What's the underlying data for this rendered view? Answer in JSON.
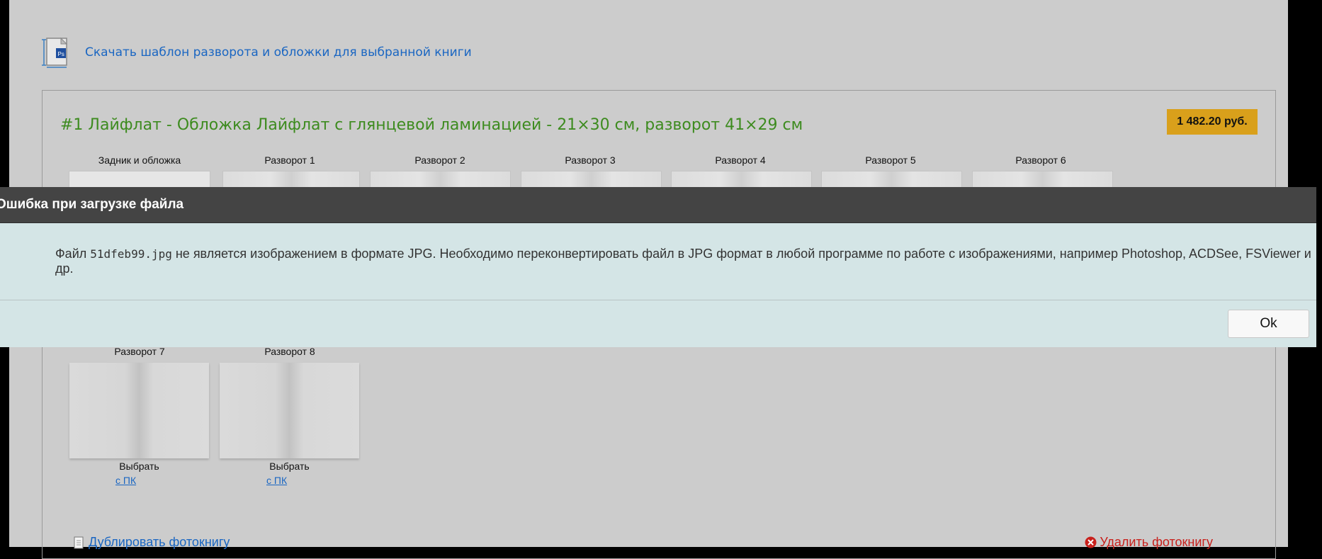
{
  "download": {
    "icon": "photoshop-template-icon",
    "link": "Скачать шаблон разворота и обложки для выбранной книги"
  },
  "order": {
    "title": "#1 Лайфлат - Обложка Лайфлат с глянцевой ламинацией - 21×30 см, разворот 41×29 см",
    "price": "1 482.20 руб.",
    "spreads_top": [
      "Задник и обложка",
      "Разворот 1",
      "Разворот 2",
      "Разворот 3",
      "Разворот 4",
      "Разворот 5",
      "Разворот 6"
    ],
    "spreads_bottom": [
      {
        "label": "Разворот 7",
        "choose": "Выбрать",
        "link": "с ПК"
      },
      {
        "label": "Разворот 8",
        "choose": "Выбрать",
        "link": "с ПК"
      }
    ],
    "duplicate": "Дублировать фотокнигу",
    "delete": "Удалить фотокнигу"
  },
  "dialog": {
    "title": "Ошибка при загрузке файла",
    "message_before": "Файл ",
    "filename": "51dfeb99.jpg",
    "message_after": " не является изображением в формате JPG. Необходимо переконвертировать файл в JPG формат в любой программе по работе с изображениями, например Photoshop, ACDSee, FSViewer и др.",
    "ok": "Ok"
  },
  "colors": {
    "accent_green": "#3d8b1f",
    "price_bg": "#d9a01b",
    "link": "#1a66c2",
    "danger": "#c8201c",
    "dialog_header": "#444444",
    "dialog_body": "#d4e5e6"
  }
}
